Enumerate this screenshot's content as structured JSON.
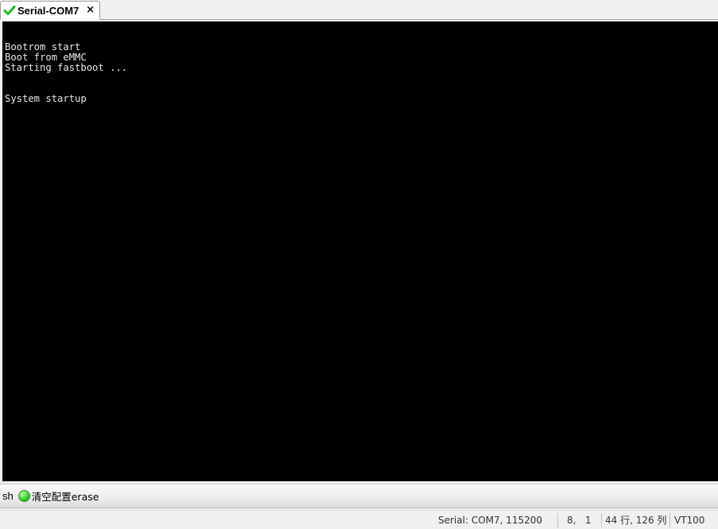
{
  "tab": {
    "label": "Serial-COM7",
    "close_label": "×",
    "status_icon": "check-icon",
    "status_color": "#1fb51f"
  },
  "terminal": {
    "background": "#000000",
    "foreground": "#e8e8e8",
    "lines": [
      "",
      "Bootrom start",
      "Boot from eMMC",
      "Starting fastboot ...",
      "",
      "",
      "System startup"
    ]
  },
  "command_bar": {
    "session_label": "sh",
    "buttons": [
      {
        "label": "清空配置erase",
        "icon": "green-led-icon"
      }
    ]
  },
  "status_bar": {
    "connection": "Serial: COM7, 115200",
    "cursor": "8,   1",
    "size": "44 行, 126 列",
    "terminal_type": "VT100"
  }
}
